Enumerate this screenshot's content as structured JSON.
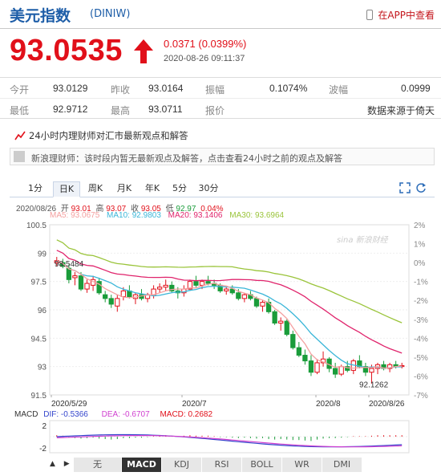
{
  "header": {
    "title": "美元指数",
    "code": "(DINIW)",
    "app_link": "在APP中查看",
    "phone_icon": "phone-icon"
  },
  "quote": {
    "price": "93.0535",
    "change": "0.0371 (0.0399%)",
    "timestamp": "2020-08-26 09:11:37",
    "direction_icon": "up-arrow-icon",
    "up_color": "#e1101a"
  },
  "stats": {
    "open_label": "今开",
    "open": "93.0129",
    "prev_close_label": "昨收",
    "prev_close": "93.0164",
    "amplitude_label": "振幅",
    "amplitude": "0.1074%",
    "wave_label": "波幅",
    "wave": "0.0999",
    "low_label": "最低",
    "low": "92.9712",
    "high_label": "最高",
    "high": "93.0711",
    "quote_label": "报价",
    "source": "数据来源于倚天"
  },
  "promo": {
    "headline": "24小时内理财师对汇市最新观点和解答",
    "notice": "新浪理财师：该时段内暂无最新观点及解答，点击查看24小时之前的观点及解答"
  },
  "tabs": [
    "1分",
    "日K",
    "周K",
    "月K",
    "年K",
    "5分",
    "30分"
  ],
  "active_tab": "日K",
  "ohlc": {
    "date": "2020/08/26",
    "open_label": "开",
    "open": "93.01",
    "high_label": "高",
    "high": "93.07",
    "close_label": "收",
    "close": "93.05",
    "low_label": "低",
    "low": "92.97",
    "change_pct": "0.04%"
  },
  "ma": {
    "ma5": "MA5: 93.0675",
    "ma10": "MA10: 92.9803",
    "ma20": "MA20: 93.1406",
    "ma30": "MA30: 93.6964"
  },
  "macd": {
    "label": "MACD",
    "dif": "DIF: -0.5366",
    "dea": "DEA: -0.6707",
    "macd": "MACD: 0.2682"
  },
  "chart_data": {
    "type": "candlestick",
    "y_ticks": [
      "100.5",
      "99",
      "97.5",
      "96",
      "94.5",
      "93",
      "91.5"
    ],
    "y_range": [
      91.5,
      100.5
    ],
    "pct_ticks": [
      "2%",
      "1%",
      "0%",
      "-1%",
      "-2%",
      "-3%",
      "-4%",
      "-5%",
      "-6%",
      "-7%"
    ],
    "x_ticks": [
      "2020/5/29",
      "2020/7",
      "2020/8",
      "2020/8/26"
    ],
    "annotations": {
      "high": "98.5484",
      "low": "92.1262"
    },
    "watermark": "sina 新浪财经",
    "macd_ticks": [
      "2",
      "-2"
    ],
    "colors": {
      "up": "#e1101a",
      "down": "#1a9c3a",
      "ma5": "#f4a0a0",
      "ma10": "#3ab6d8",
      "ma20": "#e0246c",
      "ma30": "#9ac43a"
    },
    "candles": [
      [
        98.5,
        98.8,
        98.3,
        98.6
      ],
      [
        98.5,
        98.7,
        98.2,
        98.3
      ],
      [
        98.2,
        98.4,
        97.4,
        97.6
      ],
      [
        97.7,
        98.0,
        97.3,
        97.8
      ],
      [
        97.8,
        98.0,
        97.0,
        97.1
      ],
      [
        97.1,
        97.6,
        96.9,
        97.4
      ],
      [
        97.3,
        97.8,
        97.0,
        97.6
      ],
      [
        97.5,
        97.7,
        96.8,
        96.9
      ],
      [
        96.8,
        97.0,
        96.4,
        96.6
      ],
      [
        96.6,
        96.8,
        96.1,
        96.3
      ],
      [
        96.2,
        96.8,
        95.9,
        96.6
      ],
      [
        96.7,
        97.2,
        96.5,
        97.0
      ],
      [
        97.0,
        97.3,
        96.6,
        96.7
      ],
      [
        96.6,
        96.9,
        96.3,
        96.8
      ],
      [
        96.8,
        97.1,
        96.5,
        96.6
      ],
      [
        96.6,
        96.9,
        96.4,
        96.8
      ],
      [
        96.8,
        97.3,
        96.6,
        97.1
      ],
      [
        97.1,
        97.4,
        96.9,
        97.2
      ],
      [
        97.2,
        97.6,
        97.0,
        97.3
      ],
      [
        97.3,
        97.5,
        96.9,
        97.0
      ],
      [
        97.0,
        97.2,
        96.6,
        96.9
      ],
      [
        96.9,
        97.3,
        96.7,
        97.1
      ],
      [
        97.1,
        97.6,
        97.0,
        97.5
      ],
      [
        97.5,
        97.8,
        97.2,
        97.3
      ],
      [
        97.3,
        97.6,
        97.1,
        97.5
      ],
      [
        97.5,
        97.8,
        97.3,
        97.4
      ],
      [
        97.4,
        97.6,
        97.1,
        97.3
      ],
      [
        97.3,
        97.4,
        96.9,
        97.0
      ],
      [
        97.0,
        97.2,
        96.8,
        97.1
      ],
      [
        97.1,
        97.3,
        96.8,
        96.9
      ],
      [
        96.9,
        97.1,
        96.5,
        96.6
      ],
      [
        96.6,
        96.9,
        96.4,
        96.8
      ],
      [
        96.8,
        97.0,
        96.5,
        96.6
      ],
      [
        96.6,
        96.7,
        96.1,
        96.2
      ],
      [
        96.2,
        96.5,
        95.9,
        96.4
      ],
      [
        96.4,
        96.6,
        95.8,
        95.9
      ],
      [
        95.9,
        96.0,
        95.2,
        95.3
      ],
      [
        95.3,
        95.6,
        94.9,
        95.4
      ],
      [
        95.4,
        95.5,
        94.6,
        94.7
      ],
      [
        94.7,
        94.9,
        93.9,
        94.0
      ],
      [
        94.0,
        94.3,
        93.5,
        93.6
      ],
      [
        93.6,
        93.9,
        93.1,
        93.3
      ],
      [
        93.3,
        93.6,
        92.5,
        92.7
      ],
      [
        92.7,
        93.4,
        92.6,
        93.2
      ],
      [
        93.2,
        93.8,
        93.0,
        93.4
      ],
      [
        93.4,
        93.5,
        92.7,
        92.9
      ],
      [
        92.9,
        93.2,
        92.4,
        92.6
      ],
      [
        92.6,
        93.1,
        92.5,
        93.0
      ],
      [
        93.0,
        93.3,
        92.7,
        92.8
      ],
      [
        92.8,
        93.4,
        92.6,
        93.3
      ],
      [
        93.3,
        93.6,
        92.9,
        93.0
      ],
      [
        93.0,
        93.2,
        92.5,
        92.7
      ],
      [
        92.7,
        93.1,
        92.1,
        92.9
      ],
      [
        92.9,
        93.2,
        92.6,
        93.1
      ],
      [
        93.1,
        93.3,
        92.8,
        92.9
      ],
      [
        92.9,
        93.2,
        92.7,
        93.1
      ],
      [
        93.1,
        93.3,
        92.9,
        93.0
      ],
      [
        93.0,
        93.2,
        92.9,
        93.05
      ]
    ]
  },
  "bottom_tabs": [
    "无",
    "MACD",
    "KDJ",
    "RSI",
    "BOLL",
    "WR",
    "DMI"
  ],
  "active_bottom_tab": "MACD"
}
